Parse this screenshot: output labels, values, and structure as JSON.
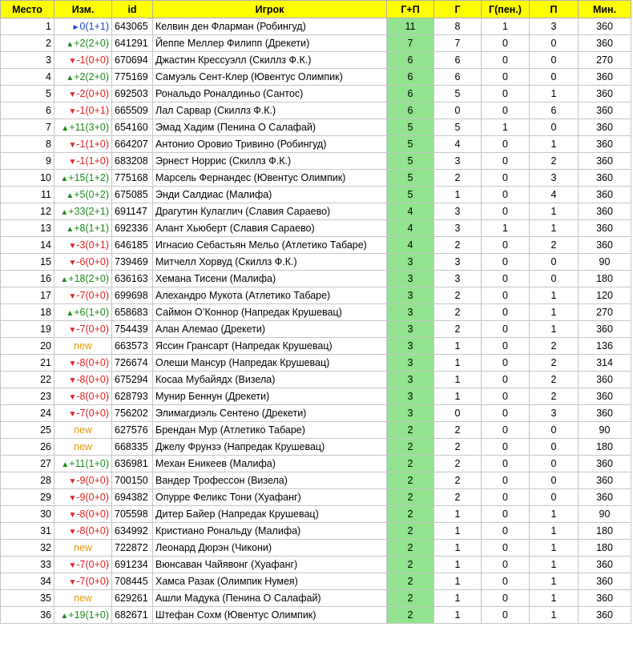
{
  "headers": [
    "Место",
    "Изм.",
    "id",
    "Игрок",
    "Г+П",
    "Г",
    "Г(пен.)",
    "П",
    "Мин."
  ],
  "colors": {
    "header_bg": "#ffff00",
    "gp_bg": "#92e28f",
    "up": "#1d8a1d",
    "down": "#e02020",
    "same": "#1f3fd8",
    "new": "#e69a00"
  },
  "rows": [
    {
      "place": "1",
      "dir": "same",
      "change": "0(1+1)",
      "id": "643065",
      "player": "Келвин ден Фларман (Робингуд)",
      "gp": "11",
      "g": "8",
      "gpen": "1",
      "a": "3",
      "min": "360"
    },
    {
      "place": "2",
      "dir": "up",
      "change": "+2(2+0)",
      "id": "641291",
      "player": "Йеппе Меллер Филипп (Дрекети)",
      "gp": "7",
      "g": "7",
      "gpen": "0",
      "a": "0",
      "min": "360"
    },
    {
      "place": "3",
      "dir": "down",
      "change": "-1(0+0)",
      "id": "670694",
      "player": "Джастин Крессуэлл (Скиллз Ф.К.)",
      "gp": "6",
      "g": "6",
      "gpen": "0",
      "a": "0",
      "min": "270"
    },
    {
      "place": "4",
      "dir": "up",
      "change": "+2(2+0)",
      "id": "775169",
      "player": "Самуэль Сент-Клер (Ювентус Олимпик)",
      "gp": "6",
      "g": "6",
      "gpen": "0",
      "a": "0",
      "min": "360"
    },
    {
      "place": "5",
      "dir": "down",
      "change": "-2(0+0)",
      "id": "692503",
      "player": "Рональдо Роналдиньо (Сантос)",
      "gp": "6",
      "g": "5",
      "gpen": "0",
      "a": "1",
      "min": "360"
    },
    {
      "place": "6",
      "dir": "down",
      "change": "-1(0+1)",
      "id": "665509",
      "player": "Лал Сарвар (Скиллз Ф.К.)",
      "gp": "6",
      "g": "0",
      "gpen": "0",
      "a": "6",
      "min": "360"
    },
    {
      "place": "7",
      "dir": "up",
      "change": "+11(3+0)",
      "id": "654160",
      "player": "Эмад Хадим (Пенина О Салафай)",
      "gp": "5",
      "g": "5",
      "gpen": "1",
      "a": "0",
      "min": "360"
    },
    {
      "place": "8",
      "dir": "down",
      "change": "-1(1+0)",
      "id": "664207",
      "player": "Антонио Оровио Тривино (Робингуд)",
      "gp": "5",
      "g": "4",
      "gpen": "0",
      "a": "1",
      "min": "360"
    },
    {
      "place": "9",
      "dir": "down",
      "change": "-1(1+0)",
      "id": "683208",
      "player": "Эрнест Норрис (Скиллз Ф.К.)",
      "gp": "5",
      "g": "3",
      "gpen": "0",
      "a": "2",
      "min": "360"
    },
    {
      "place": "10",
      "dir": "up",
      "change": "+15(1+2)",
      "id": "775168",
      "player": "Марсель Фернандес (Ювентус Олимпик)",
      "gp": "5",
      "g": "2",
      "gpen": "0",
      "a": "3",
      "min": "360"
    },
    {
      "place": "11",
      "dir": "up",
      "change": "+5(0+2)",
      "id": "675085",
      "player": "Энди Салдиас (Малифа)",
      "gp": "5",
      "g": "1",
      "gpen": "0",
      "a": "4",
      "min": "360"
    },
    {
      "place": "12",
      "dir": "up",
      "change": "+33(2+1)",
      "id": "691147",
      "player": "Драгутин Кулаглич (Славия Сараево)",
      "gp": "4",
      "g": "3",
      "gpen": "0",
      "a": "1",
      "min": "360"
    },
    {
      "place": "13",
      "dir": "up",
      "change": "+8(1+1)",
      "id": "692336",
      "player": "Алант Хьюберт (Славия Сараево)",
      "gp": "4",
      "g": "3",
      "gpen": "1",
      "a": "1",
      "min": "360"
    },
    {
      "place": "14",
      "dir": "down",
      "change": "-3(0+1)",
      "id": "646185",
      "player": "Игнасио Себастьян Мельо (Атлетико Табаре)",
      "gp": "4",
      "g": "2",
      "gpen": "0",
      "a": "2",
      "min": "360"
    },
    {
      "place": "15",
      "dir": "down",
      "change": "-6(0+0)",
      "id": "739469",
      "player": "Митчелл Хорвуд (Скиллз Ф.К.)",
      "gp": "3",
      "g": "3",
      "gpen": "0",
      "a": "0",
      "min": "90"
    },
    {
      "place": "16",
      "dir": "up",
      "change": "+18(2+0)",
      "id": "636163",
      "player": "Хемана Тисени (Малифа)",
      "gp": "3",
      "g": "3",
      "gpen": "0",
      "a": "0",
      "min": "180"
    },
    {
      "place": "17",
      "dir": "down",
      "change": "-7(0+0)",
      "id": "699698",
      "player": "Алехандро Мукота (Атлетико Табаре)",
      "gp": "3",
      "g": "2",
      "gpen": "0",
      "a": "1",
      "min": "120"
    },
    {
      "place": "18",
      "dir": "up",
      "change": "+6(1+0)",
      "id": "658683",
      "player": "Саймон О’Коннор (Напредак Крушевац)",
      "gp": "3",
      "g": "2",
      "gpen": "0",
      "a": "1",
      "min": "270"
    },
    {
      "place": "19",
      "dir": "down",
      "change": "-7(0+0)",
      "id": "754439",
      "player": "Алан Алемао (Дрекети)",
      "gp": "3",
      "g": "2",
      "gpen": "0",
      "a": "1",
      "min": "360"
    },
    {
      "place": "20",
      "dir": "new",
      "change": "new",
      "id": "663573",
      "player": "Яссин Грансарт (Напредак Крушевац)",
      "gp": "3",
      "g": "1",
      "gpen": "0",
      "a": "2",
      "min": "136"
    },
    {
      "place": "21",
      "dir": "down",
      "change": "-8(0+0)",
      "id": "726674",
      "player": "Олеши Мансур (Напредак Крушевац)",
      "gp": "3",
      "g": "1",
      "gpen": "0",
      "a": "2",
      "min": "314"
    },
    {
      "place": "22",
      "dir": "down",
      "change": "-8(0+0)",
      "id": "675294",
      "player": "Косаа Мубайядх (Визела)",
      "gp": "3",
      "g": "1",
      "gpen": "0",
      "a": "2",
      "min": "360"
    },
    {
      "place": "23",
      "dir": "down",
      "change": "-8(0+0)",
      "id": "628793",
      "player": "Мунир Беннун (Дрекети)",
      "gp": "3",
      "g": "1",
      "gpen": "0",
      "a": "2",
      "min": "360"
    },
    {
      "place": "24",
      "dir": "down",
      "change": "-7(0+0)",
      "id": "756202",
      "player": "Элимагдиэль Сентено (Дрекети)",
      "gp": "3",
      "g": "0",
      "gpen": "0",
      "a": "3",
      "min": "360"
    },
    {
      "place": "25",
      "dir": "new",
      "change": "new",
      "id": "627576",
      "player": "Брендан Мур (Атлетико Табаре)",
      "gp": "2",
      "g": "2",
      "gpen": "0",
      "a": "0",
      "min": "90"
    },
    {
      "place": "26",
      "dir": "new",
      "change": "new",
      "id": "668335",
      "player": "Джелу Фрунзэ (Напредак Крушевац)",
      "gp": "2",
      "g": "2",
      "gpen": "0",
      "a": "0",
      "min": "180"
    },
    {
      "place": "27",
      "dir": "up",
      "change": "+11(1+0)",
      "id": "636981",
      "player": "Механ Еникеев (Малифа)",
      "gp": "2",
      "g": "2",
      "gpen": "0",
      "a": "0",
      "min": "360"
    },
    {
      "place": "28",
      "dir": "down",
      "change": "-9(0+0)",
      "id": "700150",
      "player": "Вандер Трофессон (Визела)",
      "gp": "2",
      "g": "2",
      "gpen": "0",
      "a": "0",
      "min": "360"
    },
    {
      "place": "29",
      "dir": "down",
      "change": "-9(0+0)",
      "id": "694382",
      "player": "Опурре Феликс Тони (Хуафанг)",
      "gp": "2",
      "g": "2",
      "gpen": "0",
      "a": "0",
      "min": "360"
    },
    {
      "place": "30",
      "dir": "down",
      "change": "-8(0+0)",
      "id": "705598",
      "player": "Дитер Байер (Напредак Крушевац)",
      "gp": "2",
      "g": "1",
      "gpen": "0",
      "a": "1",
      "min": "90"
    },
    {
      "place": "31",
      "dir": "down",
      "change": "-8(0+0)",
      "id": "634992",
      "player": "Кристиано Рональду (Малифа)",
      "gp": "2",
      "g": "1",
      "gpen": "0",
      "a": "1",
      "min": "180"
    },
    {
      "place": "32",
      "dir": "new",
      "change": "new",
      "id": "722872",
      "player": "Леонард Дюрэн (Чикони)",
      "gp": "2",
      "g": "1",
      "gpen": "0",
      "a": "1",
      "min": "180"
    },
    {
      "place": "33",
      "dir": "down",
      "change": "-7(0+0)",
      "id": "691234",
      "player": "Вюнсаван Чайявонг (Хуафанг)",
      "gp": "2",
      "g": "1",
      "gpen": "0",
      "a": "1",
      "min": "360"
    },
    {
      "place": "34",
      "dir": "down",
      "change": "-7(0+0)",
      "id": "708445",
      "player": "Хамса Разак (Олимпик Нумея)",
      "gp": "2",
      "g": "1",
      "gpen": "0",
      "a": "1",
      "min": "360"
    },
    {
      "place": "35",
      "dir": "new",
      "change": "new",
      "id": "629261",
      "player": "Ашли Мадука (Пенина О Салафай)",
      "gp": "2",
      "g": "1",
      "gpen": "0",
      "a": "1",
      "min": "360"
    },
    {
      "place": "36",
      "dir": "up",
      "change": "+19(1+0)",
      "id": "682671",
      "player": "Штефан Сохм (Ювентус Олимпик)",
      "gp": "2",
      "g": "1",
      "gpen": "0",
      "a": "1",
      "min": "360"
    }
  ]
}
